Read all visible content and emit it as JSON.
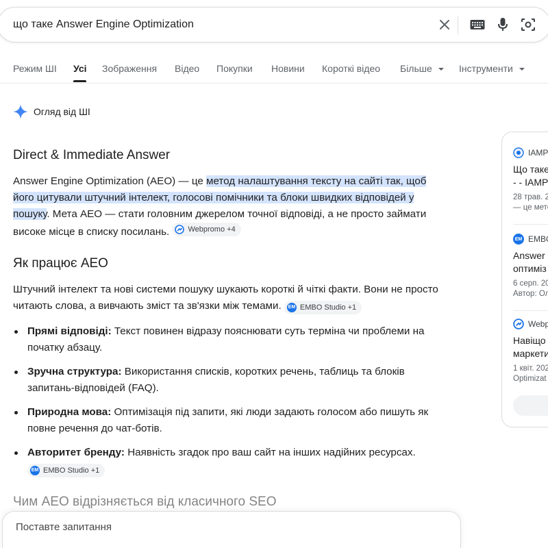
{
  "search": {
    "query": "що таке Answer Engine Optimization"
  },
  "tabs": [
    {
      "label": "Режим ШІ"
    },
    {
      "label": "Усі"
    },
    {
      "label": "Зображення"
    },
    {
      "label": "Відео"
    },
    {
      "label": "Покупки"
    },
    {
      "label": "Новини"
    },
    {
      "label": "Короткі відео"
    },
    {
      "label": "Більше"
    },
    {
      "label": "Інструменти"
    }
  ],
  "ai_overview": {
    "header": "Огляд від ШІ",
    "h1": "Direct & Immediate Answer",
    "p1": {
      "a": "Answer Engine Optimization (AEO) — це ",
      "hl": "метод налаштування тексту на сайті так, щоб його цитували штучний інтелект, голосові помічники та блоки швидких відповідей у пошуку",
      "b": ". Мета AEO — стати головним джерелом точної відповіді, а не просто займати високе місце в списку посилань."
    },
    "chip1": "Webpromo +4",
    "h2": "Як працює AEO",
    "p2": "Штучний інтелект та нові системи пошуку шукають короткі й чіткі факти. Вони не просто читають слова, а вивчають зміст та зв'язки між темами.",
    "chip2": "EMBO Studio +1",
    "bullets": [
      {
        "term": "Прямі відповіді:",
        "text": " Текст повинен відразу пояснювати суть терміна чи проблеми на початку абзацу."
      },
      {
        "term": "Зручна структура:",
        "text": " Використання списків, коротких речень, таблиць та блоків запитань-відповідей (FAQ)."
      },
      {
        "term": "Природна мова:",
        "text": " Оптимізація під запити, які люди задають голосом або пишуть як повне речення до чат-ботів."
      },
      {
        "term": "Авторитет бренду:",
        "text": " Наявність згадок про ваш сайт на інших надійних ресурсах."
      }
    ],
    "chip3": "EMBO Studio +1",
    "h3": "Чим AEO відрізняється від класичного SEO"
  },
  "ask": {
    "placeholder": "Поставте запитання"
  },
  "sources": [
    {
      "site": "IAMP",
      "title1": "Що таке",
      "title2": "- - IAMP",
      "meta1": "28 трав. 2",
      "meta2": "— це мето"
    },
    {
      "site": "EMBO",
      "title1": "Answer",
      "title2": "оптиміз",
      "meta1": "6 серп. 20",
      "meta2": "Автор: Ол"
    },
    {
      "site": "Webp",
      "title1": "Навіщо",
      "title2": "маркети",
      "meta1": "1 квіт. 202",
      "meta2": "Optimizat"
    }
  ],
  "colors": {
    "accent_highlight": "#d3e3fd",
    "chip_bg": "#f1f3f4",
    "embo_blue": "#1a73e8",
    "gemini_blue": "#4285f4"
  }
}
